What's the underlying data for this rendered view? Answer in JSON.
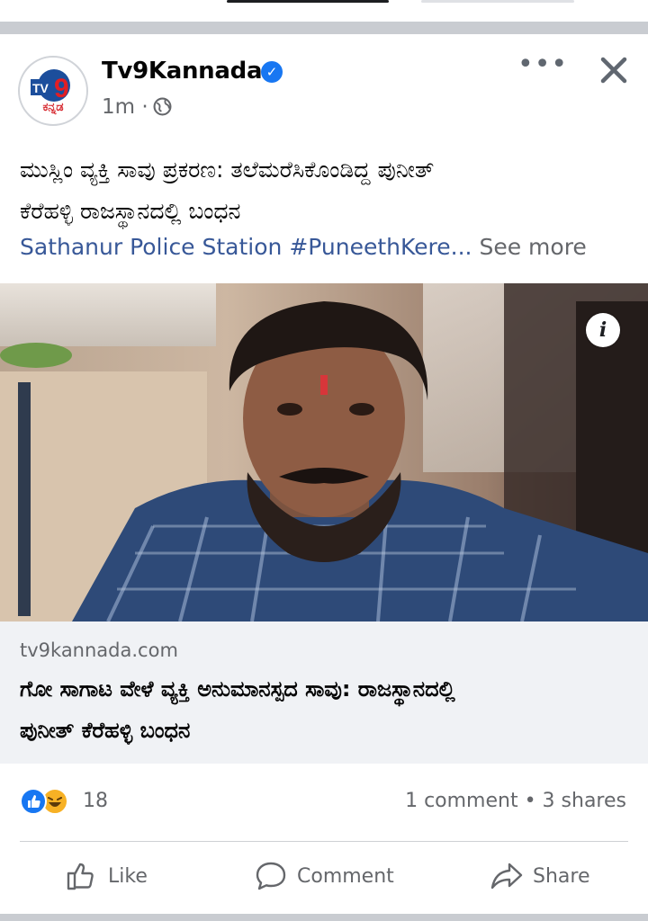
{
  "post": {
    "page_name": "Tv9Kannada",
    "time": "1m ·",
    "logo_text": "ಕನ್ನಡ",
    "logo_mark": "TV9",
    "text_line1": "ಮುಸ್ಲಿಂ ವ್ಯಕ್ತಿ ಸಾವು ಪ್ರಕರಣ: ತಲೆಮರೆಸಿಕೊಂಡಿದ್ದ ಪುನೀತ್",
    "text_line2": "ಕೆರೆಹಳ್ಳಿ ರಾಜಸ್ಥಾನದಲ್ಲಿ ಬಂಧನ",
    "hashtag_text": "Sathanur Police Station #PuneethKere...",
    "see_more": " See more",
    "info_label": "i"
  },
  "link_preview": {
    "domain": "tv9kannada.com",
    "title_line1": "ಗೋ ಸಾಗಾಟ ವೇಳೆ ವ್ಯಕ್ತಿ ಅನುಮಾನಸ್ಪದ ಸಾವು: ರಾಜಸ್ಥಾನದಲ್ಲಿ",
    "title_line2": "ಪುನೀತ್ ಕೆರೆಹಳ್ಳಿ ಬಂಧನ"
  },
  "engagement": {
    "reaction_count": "18",
    "stats": "1 comment • 3 shares"
  },
  "actions": {
    "like": "Like",
    "comment": "Comment",
    "share": "Share"
  },
  "colors": {
    "brand_blue": "#1877f2",
    "hashtag": "#385898",
    "muted": "#65676b"
  }
}
